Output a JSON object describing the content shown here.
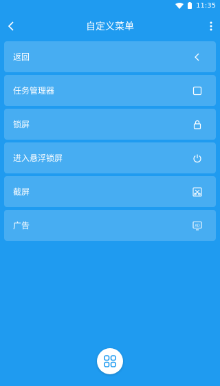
{
  "status": {
    "time": "11:35"
  },
  "appbar": {
    "title": "自定义菜单"
  },
  "menu": [
    {
      "label": "返回",
      "icon": "chevron-left-icon"
    },
    {
      "label": "任务管理器",
      "icon": "square-icon"
    },
    {
      "label": "锁屏",
      "icon": "lock-icon"
    },
    {
      "label": "进入悬浮锁屏",
      "icon": "power-icon"
    },
    {
      "label": "截屏",
      "icon": "screenshot-icon"
    },
    {
      "label": "广告",
      "icon": "ad-icon"
    }
  ],
  "colors": {
    "background": "#1f9bf0",
    "fab": "#ffffff",
    "fab_icon": "#1f9bf0"
  }
}
